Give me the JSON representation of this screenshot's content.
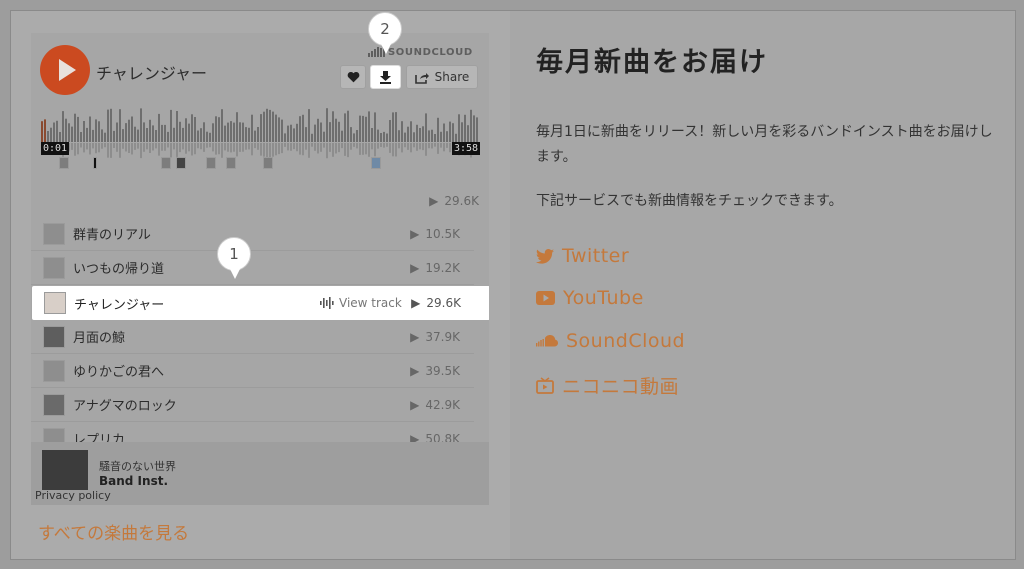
{
  "player": {
    "title": "チャレンジャー",
    "brand": "SOUNDCLOUD",
    "share_label": "Share",
    "time_start": "0:01",
    "time_end": "3:58",
    "total_plays": "29.6K"
  },
  "tracks": [
    {
      "title": "群青のリアル",
      "plays": "10.5K"
    },
    {
      "title": "いつもの帰り道",
      "plays": "19.2K"
    },
    {
      "title": "チャレンジャー",
      "plays": "29.6K",
      "view_track": "View track"
    },
    {
      "title": "月面の鯨",
      "plays": "37.9K"
    },
    {
      "title": "ゆりかごの君へ",
      "plays": "39.5K"
    },
    {
      "title": "アナグマのロック",
      "plays": "42.9K"
    },
    {
      "title": "レプリカ",
      "plays": "50.8K"
    }
  ],
  "album": {
    "name": "騒音のない世界",
    "artist": "Band Inst.",
    "privacy": "Privacy policy"
  },
  "see_all": "すべての楽曲を見る",
  "callouts": {
    "one": "1",
    "two": "2"
  },
  "info": {
    "heading": "毎月新曲をお届け",
    "description": "毎月1日に新曲をリリース！新しい月を彩るバンドインスト曲をお届けします。",
    "note": "下記サービスでも新曲情報をチェックできます。"
  },
  "links": {
    "twitter": "Twitter",
    "youtube": "YouTube",
    "soundcloud": "SoundCloud",
    "niconico": "ニコニコ動画"
  },
  "colors": {
    "accent": "#c4793c",
    "play_button": "#cb4a20"
  }
}
